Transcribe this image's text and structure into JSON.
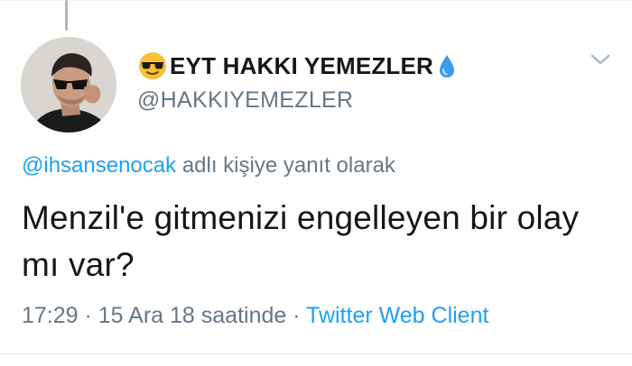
{
  "tweet": {
    "author": {
      "display_name": "EYT HAKKI YEMEZLER",
      "handle": "@HAKKIYEMEZLER",
      "emoji_icon": "sunglasses-face-emoji",
      "badge_icon": "blue-droplet-emoji"
    },
    "reply_context": {
      "mention": "@ihsansenocak",
      "suffix": "adlı kişiye yanıt olarak"
    },
    "text": "Menzil'e gitmenizi engelleyen bir olay mı var?",
    "meta": {
      "timestamp": "17:29 · 15 Ara 18 saatinde ·",
      "client": "Twitter Web Client"
    },
    "menu_icon": "chevron-down-icon"
  },
  "colors": {
    "text_primary": "#14171a",
    "text_secondary": "#657786",
    "link": "#1da1f2",
    "thread_line": "#aab8c2"
  }
}
